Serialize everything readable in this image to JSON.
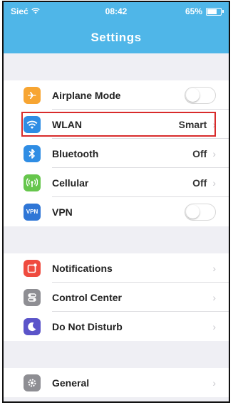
{
  "status_bar": {
    "carrier": "Sieć",
    "time": "08:42",
    "battery": "65%"
  },
  "nav": {
    "title": "Settings"
  },
  "group1": [
    {
      "label": "Airplane Mode",
      "icon": "airplane-icon",
      "color": "#f7a532",
      "control": "toggle",
      "value": ""
    },
    {
      "label": "WLAN",
      "icon": "wifi-icon",
      "color": "#2f8de4",
      "control": "value",
      "value": "Smart"
    },
    {
      "label": "Bluetooth",
      "icon": "bluetooth-icon",
      "color": "#2f8de4",
      "control": "value",
      "value": "Off"
    },
    {
      "label": "Cellular",
      "icon": "cellular-icon",
      "color": "#66c64c",
      "control": "value",
      "value": "Off"
    },
    {
      "label": "VPN",
      "icon": "vpn-icon",
      "color": "#2f76d6",
      "control": "toggle",
      "value": "",
      "badge": "VPN"
    }
  ],
  "group2": [
    {
      "label": "Notifications",
      "icon": "notifications-icon",
      "color": "#ef4b3f"
    },
    {
      "label": "Control Center",
      "icon": "control-center-icon",
      "color": "#8e8e93"
    },
    {
      "label": "Do Not Disturb",
      "icon": "moon-icon",
      "color": "#5b54c9"
    }
  ],
  "group3": [
    {
      "label": "General",
      "icon": "gear-icon",
      "color": "#8e8e93"
    }
  ],
  "highlighted_item": "WLAN",
  "highlight_color": "#d82b2b",
  "accent": "#4fb6e8"
}
